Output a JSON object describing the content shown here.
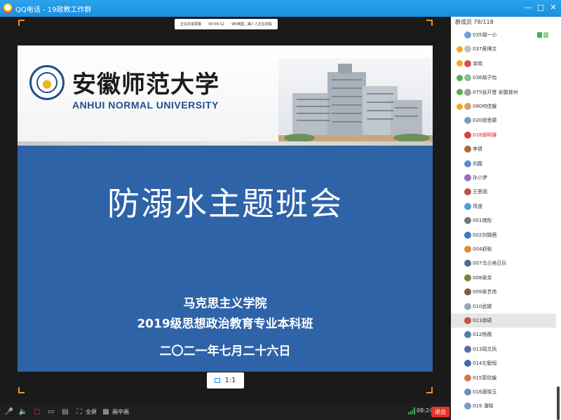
{
  "window": {
    "title": "QQ电话 - 19政教工作群",
    "controls": [
      "minimize-icon",
      "restore-icon",
      "close-icon"
    ]
  },
  "share_bar": {
    "status": "正在共享屏幕",
    "elapsed": "00:09:12",
    "viewers": "98/英国...等// 人正在观看"
  },
  "slide": {
    "university_cn": "安徽师范大学",
    "university_en": "ANHUI NORMAL UNIVERSITY",
    "title": "防溺水主题班会",
    "college": "马克思主义学院",
    "class": "2019级思想政治教育专业本科班",
    "date": "二〇二一年七月二十六日"
  },
  "ratio_button": {
    "label": "1:1"
  },
  "toolbar": {
    "fullscreen_label": "全屏",
    "pip_label": "画中画",
    "call_time": "08:24",
    "exit_label": "退出"
  },
  "sidebar": {
    "header": "群成员 78/118",
    "members": [
      {
        "name": "035胡一小",
        "role": "none",
        "avatar": "#6aa0d8",
        "speaking": true
      },
      {
        "name": "037黄博文",
        "role": "owner",
        "avatar": "#c0c0c0"
      },
      {
        "name": "余晓",
        "role": "owner",
        "avatar": "#d94f4f"
      },
      {
        "name": "036胡子怡",
        "role": "admin",
        "avatar": "#8fbc8f"
      },
      {
        "name": "075张开晋 安徽滁州",
        "role": "admin",
        "avatar": "#a0a0a0"
      },
      {
        "name": "090何佳媛",
        "role": "owner",
        "avatar": "#d9a066"
      },
      {
        "name": "020徐思颖",
        "role": "none",
        "avatar": "#7a9cc6"
      },
      {
        "name": "018胡明雅",
        "role": "none",
        "avatar": "#e23b3b",
        "highlight": true
      },
      {
        "name": "李倩",
        "role": "none",
        "avatar": "#b06b3a"
      },
      {
        "name": "刘霞",
        "role": "none",
        "avatar": "#5a8fd0"
      },
      {
        "name": "孙小梦",
        "role": "none",
        "avatar": "#9c6ac2"
      },
      {
        "name": "王思雨",
        "role": "none",
        "avatar": "#c24f4f"
      },
      {
        "name": "项虔",
        "role": "none",
        "avatar": "#4f9fd1"
      },
      {
        "name": "001储彤",
        "role": "none",
        "avatar": "#777777"
      },
      {
        "name": "002刘璐茜",
        "role": "none",
        "avatar": "#3b7bbf"
      },
      {
        "name": "004舒晗",
        "role": "none",
        "avatar": "#e08a3c"
      },
      {
        "name": "007乌兰格日乐",
        "role": "none",
        "avatar": "#556b8d"
      },
      {
        "name": "008吴京",
        "role": "none",
        "avatar": "#6e8b3d"
      },
      {
        "name": "009吴艺伟",
        "role": "none",
        "avatar": "#8a5a44"
      },
      {
        "name": "010武婕",
        "role": "none",
        "avatar": "#9aa7b5"
      },
      {
        "name": "011徐硕",
        "role": "none",
        "avatar": "#c2563b",
        "selected": true
      },
      {
        "name": "012杨薇",
        "role": "none",
        "avatar": "#4c7fb0"
      },
      {
        "name": "013周文凤",
        "role": "none",
        "avatar": "#5a6e9a"
      },
      {
        "name": "014左毅恒",
        "role": "none",
        "avatar": "#3f6fa8"
      },
      {
        "name": "015郭欣媛",
        "role": "none",
        "avatar": "#d07a52"
      },
      {
        "name": "016唐晓玉",
        "role": "none",
        "avatar": "#6b8fb8"
      },
      {
        "name": "019 潘晓",
        "role": "none",
        "avatar": "#7d99c4"
      }
    ]
  }
}
